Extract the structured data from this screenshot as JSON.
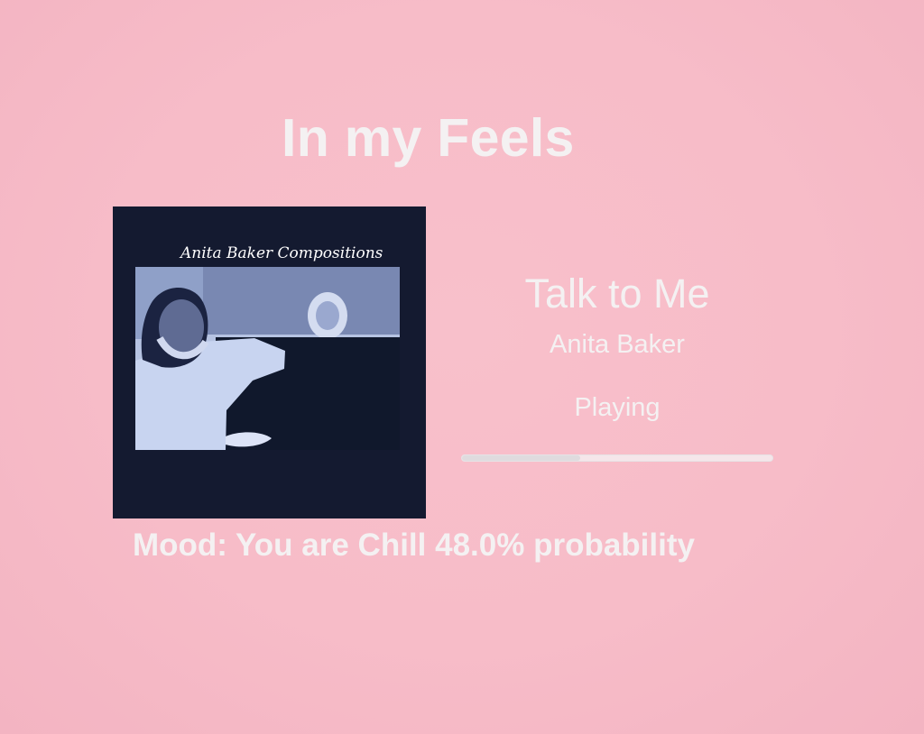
{
  "app": {
    "title": "In my Feels"
  },
  "album_art": {
    "caption": "Anita Baker Compositions",
    "alt": "Album cover artwork"
  },
  "now_playing": {
    "track_title": "Talk to Me",
    "artist": "Anita Baker",
    "status": "Playing",
    "progress_fraction": 0.38
  },
  "mood": {
    "text": "Mood: You are Chill 48.0% probability"
  },
  "colors": {
    "background": "#f7bcc8",
    "text": "#f4f1f2",
    "progress_track": "#f5e6ea",
    "progress_fill": "#dfdbde",
    "album_background": "#141a30"
  }
}
